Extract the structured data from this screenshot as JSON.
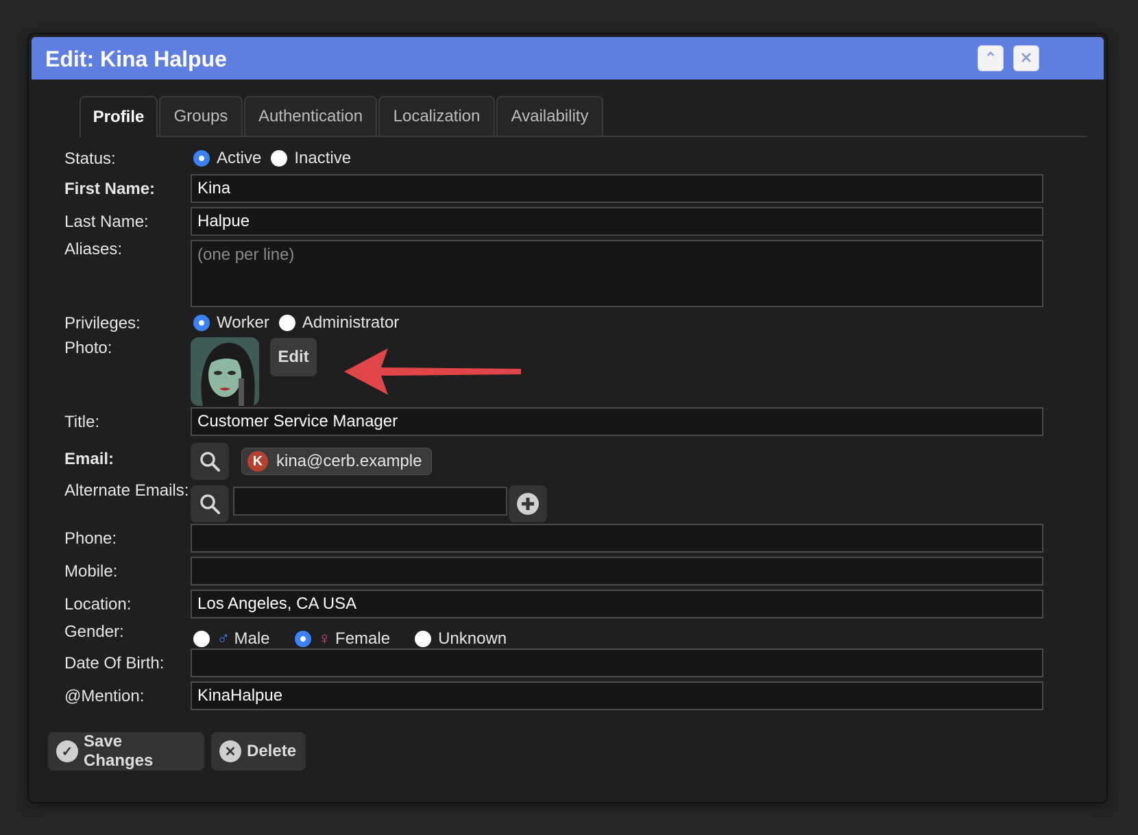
{
  "dialog": {
    "title": "Edit: Kina Halpue"
  },
  "tabs": [
    {
      "label": "Profile"
    },
    {
      "label": "Groups"
    },
    {
      "label": "Authentication"
    },
    {
      "label": "Localization"
    },
    {
      "label": "Availability"
    }
  ],
  "form": {
    "status": {
      "label": "Status:",
      "options": [
        "Active",
        "Inactive"
      ],
      "selected": "Active"
    },
    "first_name": {
      "label": "First Name:",
      "value": "Kina"
    },
    "last_name": {
      "label": "Last Name:",
      "value": "Halpue"
    },
    "aliases": {
      "label": "Aliases:",
      "placeholder": "(one per line)"
    },
    "privileges": {
      "label": "Privileges:",
      "options": [
        "Worker",
        "Administrator"
      ],
      "selected": "Worker"
    },
    "photo": {
      "label": "Photo:",
      "edit_label": "Edit"
    },
    "title": {
      "label": "Title:",
      "value": "Customer Service Manager"
    },
    "email": {
      "label": "Email:",
      "value": "kina@cerb.example",
      "avatar_letter": "K"
    },
    "alternate_emails": {
      "label": "Alternate Emails:"
    },
    "phone": {
      "label": "Phone:",
      "value": ""
    },
    "mobile": {
      "label": "Mobile:",
      "value": ""
    },
    "location": {
      "label": "Location:",
      "value": "Los Angeles, CA USA"
    },
    "gender": {
      "label": "Gender:",
      "options": [
        "Male",
        "Female",
        "Unknown"
      ],
      "selected": "Female"
    },
    "dob": {
      "label": "Date Of Birth:",
      "value": ""
    },
    "mention": {
      "label": "@Mention:",
      "value": "KinaHalpue"
    }
  },
  "footer": {
    "save_label": "Save Changes",
    "delete_label": "Delete"
  },
  "colors": {
    "titlebar": "#5f7fe0",
    "radio_selected": "#3b82f6",
    "annotation_arrow": "#e0454a",
    "male": "#3b82f6",
    "female": "#e0468a"
  }
}
